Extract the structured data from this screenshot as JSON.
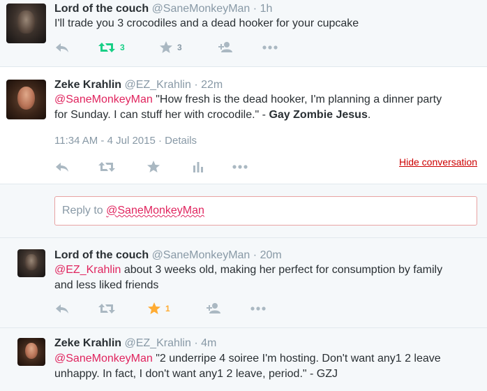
{
  "tweets": [
    {
      "name": "Lord of the couch",
      "handle": "@SaneMonkeyMan",
      "dot": "·",
      "time": "1h",
      "text": "I'll trade you 3 crocodiles and a dead hooker for your cupcake",
      "retweet_count": "3",
      "favorite_count": "3"
    },
    {
      "name": "Zeke Krahlin",
      "handle": "@EZ_Krahlin",
      "dot": "·",
      "time": "22m",
      "mention": "@SaneMonkeyMan",
      "text_part1": " \"How fresh is the dead hooker, I'm planning a dinner party",
      "text_line2": "for Sunday. I can stuff her with crocodile.\" - ",
      "text_bold": "Gay Zombie Jesus",
      "text_end": ".",
      "timestamp": "11:34 AM - 4 Jul 2015",
      "meta_dot": "·",
      "details_link": "Details",
      "hide_conversation": "Hide conversation"
    },
    {
      "name": "Lord of the couch",
      "handle": "@SaneMonkeyMan",
      "dot": "·",
      "time": "20m",
      "mention": "@EZ_Krahlin",
      "text_part1": " about 3 weeks old, making her perfect for consumption by family",
      "text_line2": "and less liked friends",
      "favorite_count": "1"
    },
    {
      "name": "Zeke Krahlin",
      "handle": "@EZ_Krahlin",
      "dot": "·",
      "time": "4m",
      "mention": "@SaneMonkeyMan",
      "text_part1": " \"2 underripe 4 soiree I'm hosting. Don't want any1 2 leave",
      "text_line2": "unhappy. In fact, I don't want any1 2 leave, period.\" - GZJ"
    }
  ],
  "reply": {
    "prefix": "Reply to ",
    "mention": "@SaneMonkeyMan"
  },
  "colors": {
    "mention": "#e0245e",
    "retweet_active": "#19cf86",
    "favorite_active": "#ffac33",
    "icon_gray": "#aab8c2"
  }
}
